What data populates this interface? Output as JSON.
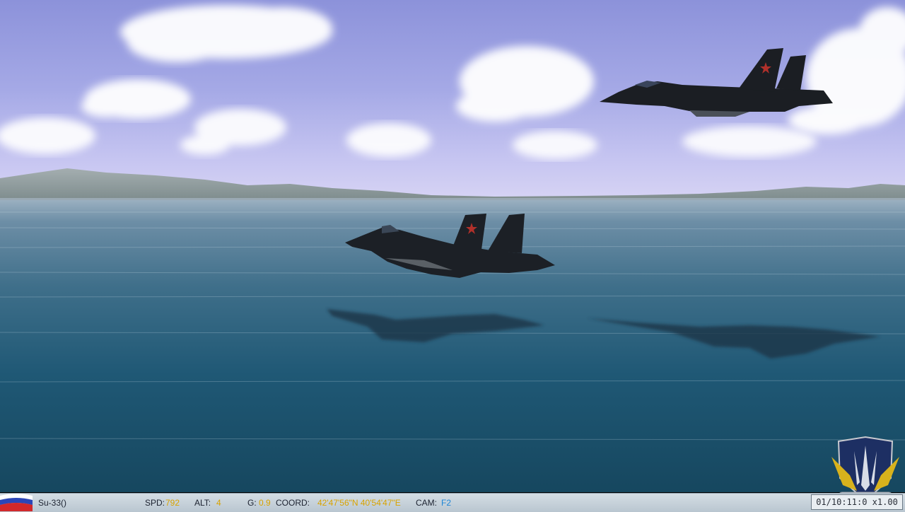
{
  "hud": {
    "aircraft": "Su-33()",
    "spd_label": "SPD:",
    "spd_value": "792",
    "alt_label": "ALT:",
    "alt_value": "4",
    "g_label": "G:",
    "g_value": "0.9",
    "coord_label": "COORD:",
    "coord_value": "42'47'56\"N  40'54'47\"E",
    "cam_label": "CAM:",
    "cam_value": "F2",
    "time": "01/10:11:0 x1.00"
  },
  "icons": {
    "flag": "russia-flag-icon",
    "emblem": "squadron-emblem-icon"
  },
  "colors": {
    "hud_value": "#d9a300",
    "hud_cam_value": "#1f86d6"
  }
}
